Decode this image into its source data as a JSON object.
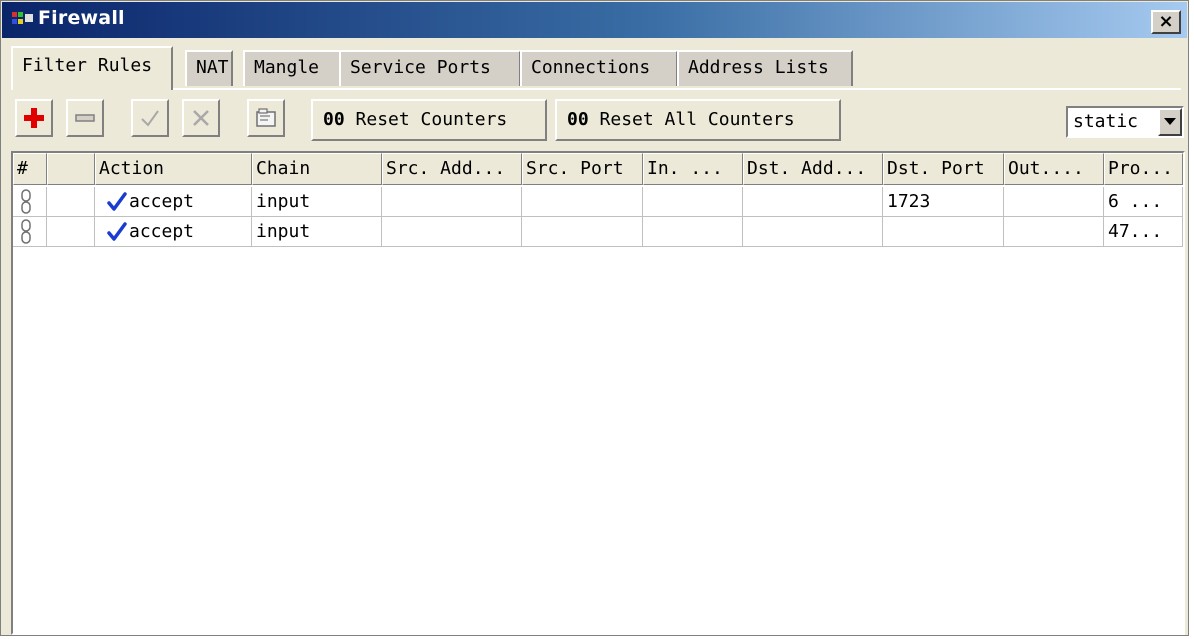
{
  "window": {
    "title": "Firewall",
    "close_label": "×"
  },
  "tabs": [
    {
      "label": "Filter Rules",
      "active": true
    },
    {
      "label": "NAT",
      "active": false
    },
    {
      "label": "Mangle",
      "active": false
    },
    {
      "label": "Service Ports",
      "active": false
    },
    {
      "label": "Connections",
      "active": false
    },
    {
      "label": "Address Lists",
      "active": false
    }
  ],
  "toolbar": {
    "icons": [
      "add-icon",
      "remove-icon",
      "enable-icon",
      "disable-icon",
      "comment-icon"
    ],
    "reset_counters_prefix": "00",
    "reset_counters_label": "Reset Counters",
    "reset_all_prefix": "00",
    "reset_all_label": "Reset All Counters",
    "filter_value": "static"
  },
  "table": {
    "headers": [
      "#",
      "",
      "Action",
      "Chain",
      "Src. Add...",
      "Src. Port",
      "In. ...",
      "Dst. Add...",
      "Dst. Port",
      "Out....",
      "Pro..."
    ],
    "rows": [
      {
        "action": "accept",
        "chain": "input",
        "src_addr": "",
        "src_port": "",
        "in_iface": "",
        "dst_addr": "",
        "dst_port": "1723",
        "out_iface": "",
        "protocol": "6 ..."
      },
      {
        "action": "accept",
        "chain": "input",
        "src_addr": "",
        "src_port": "",
        "in_iface": "",
        "dst_addr": "",
        "dst_port": "",
        "out_iface": "",
        "protocol": "47..."
      }
    ]
  },
  "colors": {
    "title_gradient_start": "#0a246a",
    "title_gradient_end": "#a6caf0",
    "add_red": "#e00000",
    "check_blue": "#1a3ccf"
  }
}
